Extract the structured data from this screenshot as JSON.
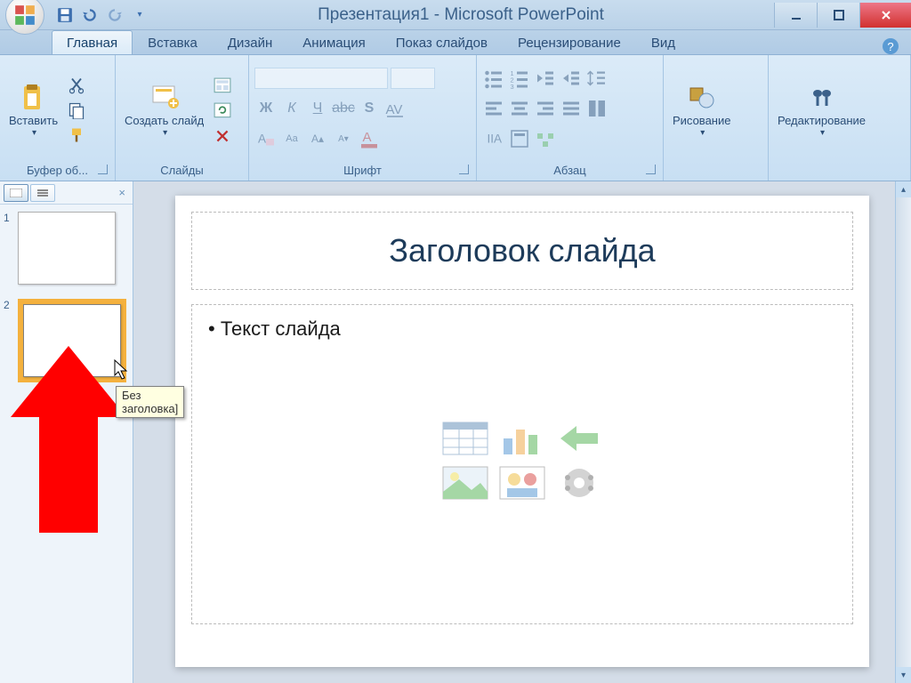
{
  "title": "Презентация1 - Microsoft PowerPoint",
  "tabs": [
    "Главная",
    "Вставка",
    "Дизайн",
    "Анимация",
    "Показ слайдов",
    "Рецензирование",
    "Вид"
  ],
  "active_tab": 0,
  "ribbon": {
    "clipboard": {
      "label": "Буфер об...",
      "paste": "Вставить"
    },
    "slides": {
      "label": "Слайды",
      "new_slide": "Создать слайд"
    },
    "font": {
      "label": "Шрифт"
    },
    "paragraph": {
      "label": "Абзац"
    },
    "drawing": {
      "label": "Рисование"
    },
    "editing": {
      "label": "Редактирование"
    }
  },
  "slide_panel": {
    "thumbs": [
      {
        "num": "1",
        "selected": false
      },
      {
        "num": "2",
        "selected": true
      }
    ],
    "tooltip": "Без заголовка]"
  },
  "slide": {
    "title_placeholder": "Заголовок слайда",
    "body_placeholder": "Текст слайда"
  }
}
